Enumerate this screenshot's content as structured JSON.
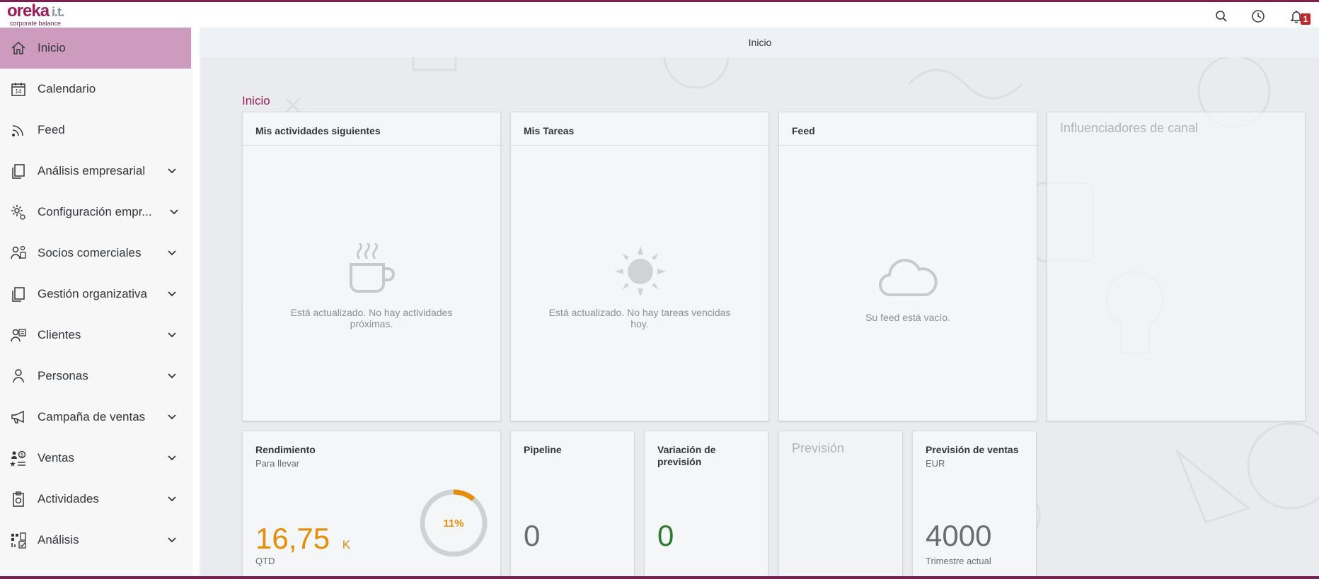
{
  "header": {
    "logo_word": "oreka",
    "logo_it": "i.t.",
    "logo_tagline": "corporate balance",
    "notification_count": "1",
    "icons": [
      "search-icon",
      "clock-icon",
      "bell-icon"
    ]
  },
  "sidebar": {
    "items": [
      {
        "label": "Inicio",
        "icon": "home-icon",
        "expandable": false,
        "active": true
      },
      {
        "label": "Calendario",
        "icon": "calendar-icon",
        "expandable": false
      },
      {
        "label": "Feed",
        "icon": "feed-icon",
        "expandable": false
      },
      {
        "label": "Análisis empresarial",
        "icon": "copy-icon",
        "expandable": true
      },
      {
        "label": "Configuración empr...",
        "icon": "settings-icon",
        "expandable": true
      },
      {
        "label": "Socios comerciales",
        "icon": "partners-icon",
        "expandable": true
      },
      {
        "label": "Gestión organizativa",
        "icon": "copy-icon",
        "expandable": true
      },
      {
        "label": "Clientes",
        "icon": "customers-icon",
        "expandable": true
      },
      {
        "label": "Personas",
        "icon": "person-icon",
        "expandable": true
      },
      {
        "label": "Campaña de ventas",
        "icon": "megaphone-icon",
        "expandable": true
      },
      {
        "label": "Ventas",
        "icon": "sales-icon",
        "expandable": true
      },
      {
        "label": "Actividades",
        "icon": "activity-icon",
        "expandable": true
      },
      {
        "label": "Análisis",
        "icon": "analytics-icon",
        "expandable": true
      }
    ]
  },
  "page": {
    "title": "Inicio",
    "breadcrumb": "Inicio"
  },
  "tiles": {
    "activities": {
      "title": "Mis actividades siguientes",
      "message": "Está actualizado. No hay actividades próximas.",
      "icon": "coffee-cup-icon"
    },
    "tasks": {
      "title": "Mis Tareas",
      "message": "Está actualizado. No hay tareas vencidas hoy.",
      "icon": "sun-icon"
    },
    "feed": {
      "title": "Feed",
      "message": "Su feed está vacío.",
      "icon": "cloud-icon"
    },
    "influencers": {
      "title": "Influenciadores de canal"
    },
    "performance": {
      "title": "Rendimiento",
      "subtitle": "Para llevar",
      "value": "16,75",
      "unit": "K",
      "period": "QTD",
      "progress_label": "11%",
      "progress": 0.11
    },
    "pipeline": {
      "title": "Pipeline",
      "value": "0"
    },
    "forecast_variation": {
      "title": "Variación de previsión",
      "value": "0"
    },
    "forecast": {
      "title": "Previsión"
    },
    "sales_forecast": {
      "title": "Previsión de ventas",
      "currency": "EUR",
      "value": "4000",
      "period": "Trimestre actual"
    }
  },
  "colors": {
    "brand": "#9b1d5a",
    "active_nav": "#cd9bbd",
    "performance": "#e78c07",
    "positive": "#2b7d2b"
  }
}
